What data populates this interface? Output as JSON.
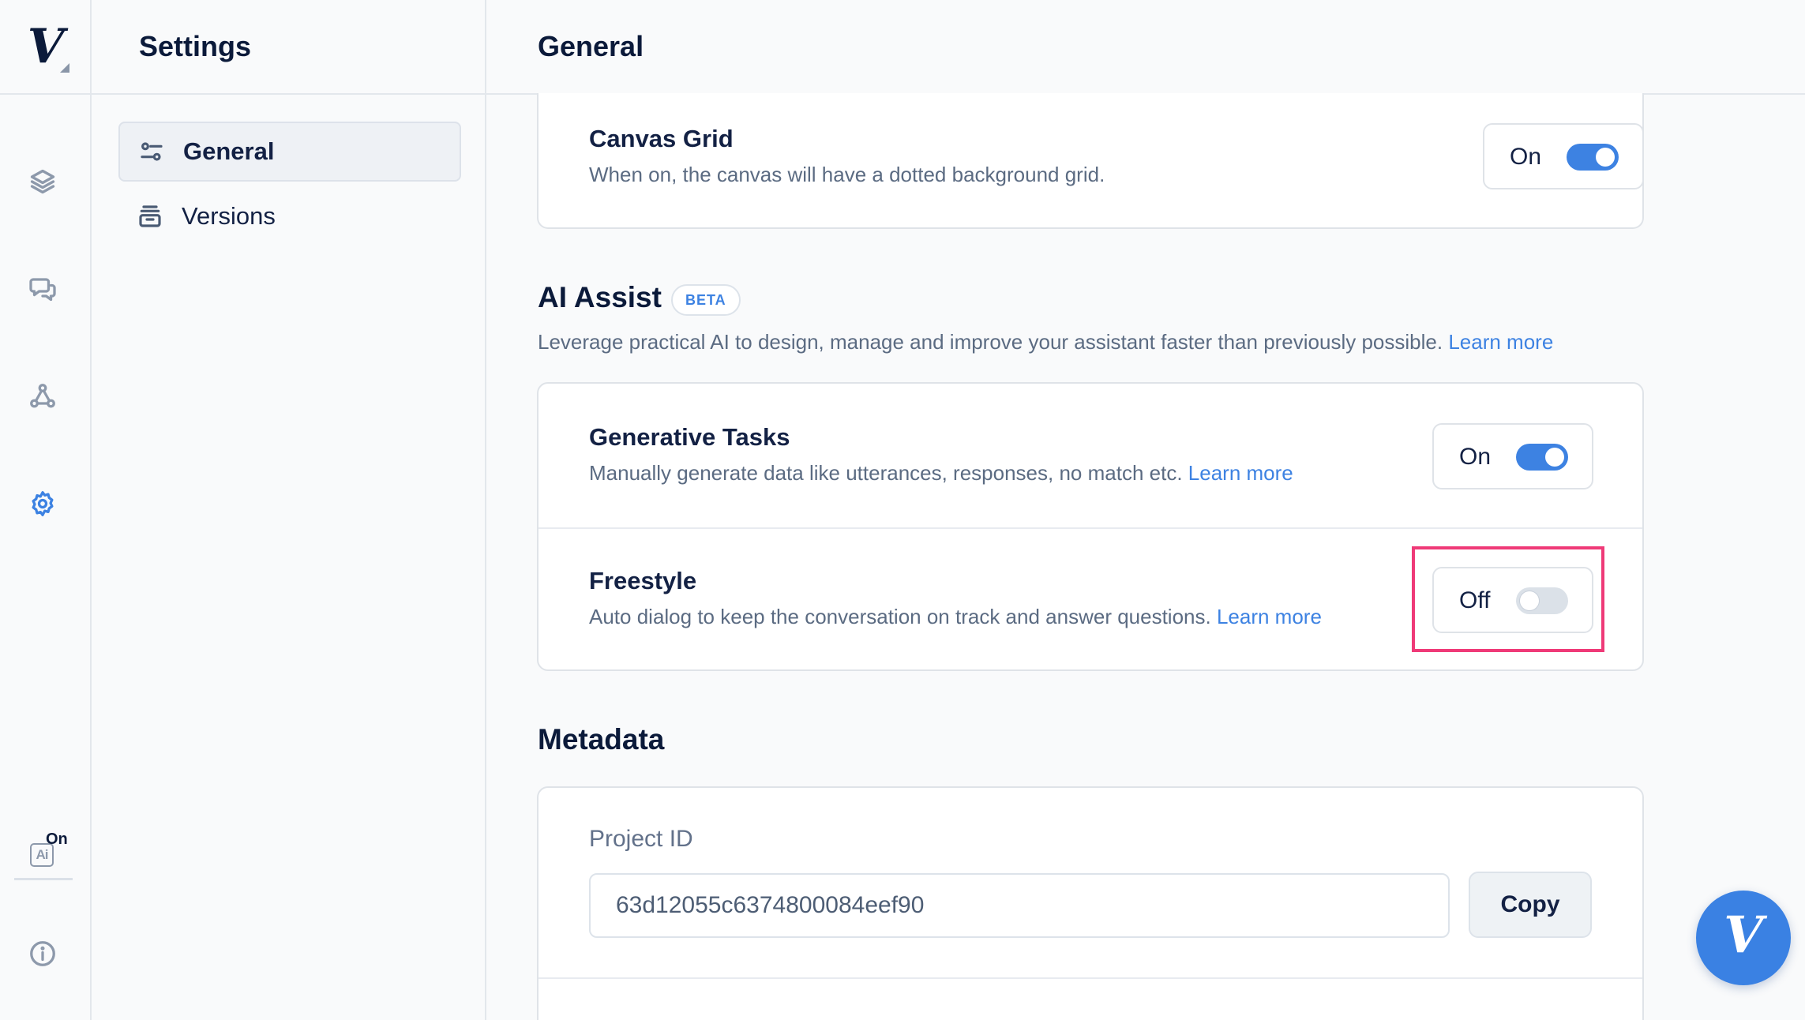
{
  "rail": {
    "logo": "V",
    "items": [
      {
        "name": "layers-icon"
      },
      {
        "name": "chat-icon"
      },
      {
        "name": "workflow-icon"
      },
      {
        "name": "settings-icon",
        "active": true
      }
    ],
    "ai_toggle": {
      "icon_text": "Ai",
      "state": "On"
    }
  },
  "nav": {
    "title": "Settings",
    "items": [
      {
        "label": "General",
        "icon": "sliders-icon",
        "active": true
      },
      {
        "label": "Versions",
        "icon": "archive-icon",
        "active": false
      }
    ]
  },
  "main": {
    "title": "General",
    "canvas_grid": {
      "title": "Canvas Grid",
      "description": "When on, the canvas will have a dotted background grid.",
      "toggle_label": "On",
      "enabled": true
    },
    "ai_assist": {
      "title": "AI Assist",
      "badge": "BETA",
      "description": "Leverage practical AI to design, manage and improve your assistant faster than previously possible.",
      "learn_more": "Learn more",
      "rows": [
        {
          "title": "Generative Tasks",
          "description": "Manually generate data like utterances, responses, no match etc.",
          "learn_more": "Learn more",
          "toggle_label": "On",
          "enabled": true
        },
        {
          "title": "Freestyle",
          "description": "Auto dialog to keep the conversation on track and answer questions.",
          "learn_more": "Learn more",
          "toggle_label": "Off",
          "enabled": false
        }
      ]
    },
    "metadata": {
      "title": "Metadata",
      "project_id_label": "Project ID",
      "project_id_value": "63d12055c6374800084eef90",
      "copy_label": "Copy"
    }
  },
  "fab": {
    "logo": "V"
  },
  "colors": {
    "accent": "#3d82e2",
    "highlight": "#ef3a78",
    "text_dark": "#132144"
  }
}
